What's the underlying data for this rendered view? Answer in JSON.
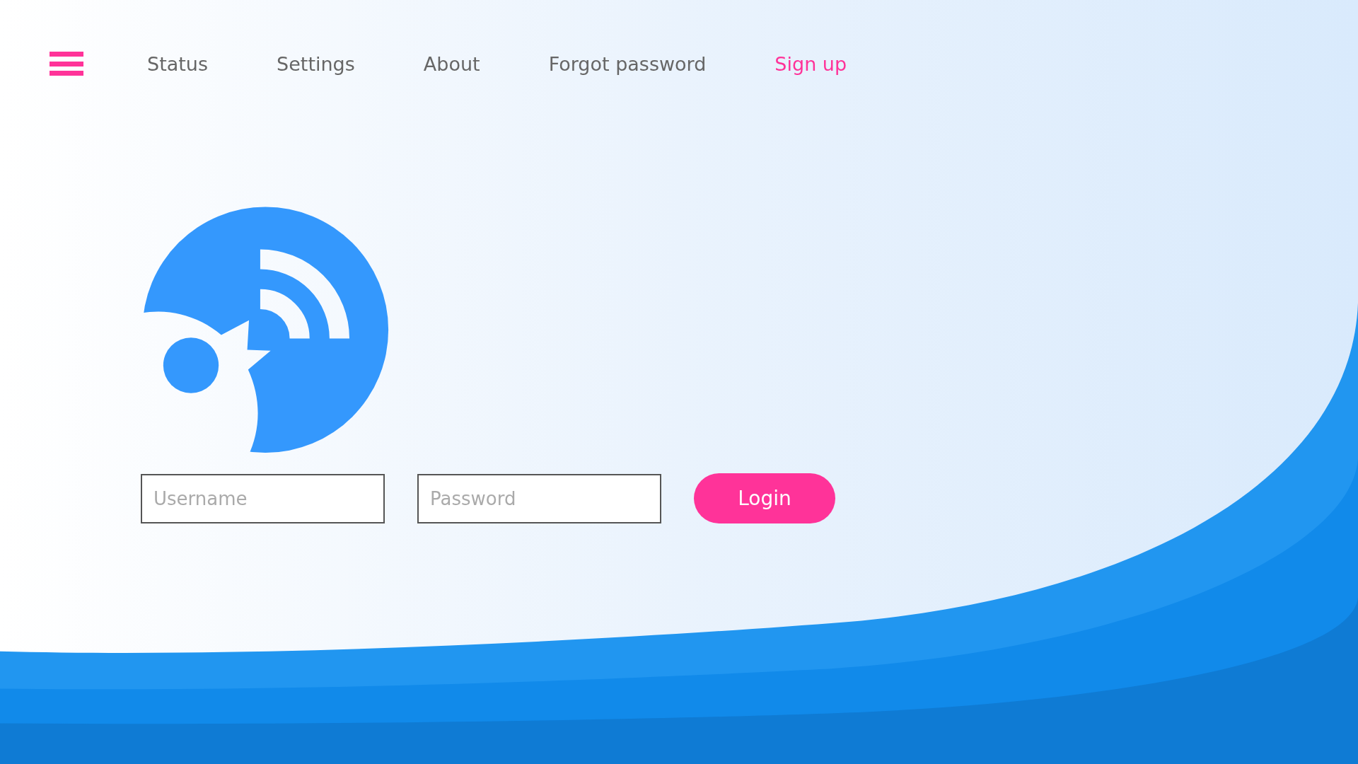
{
  "nav": {
    "items": [
      {
        "label": "Status",
        "selected": false
      },
      {
        "label": "Settings",
        "selected": false
      },
      {
        "label": "About",
        "selected": false
      },
      {
        "label": "Forgot password",
        "selected": false
      },
      {
        "label": "Sign up",
        "selected": true
      }
    ]
  },
  "login": {
    "username": {
      "placeholder": "Username"
    },
    "password": {
      "placeholder": "Password"
    },
    "button": "Login"
  }
}
